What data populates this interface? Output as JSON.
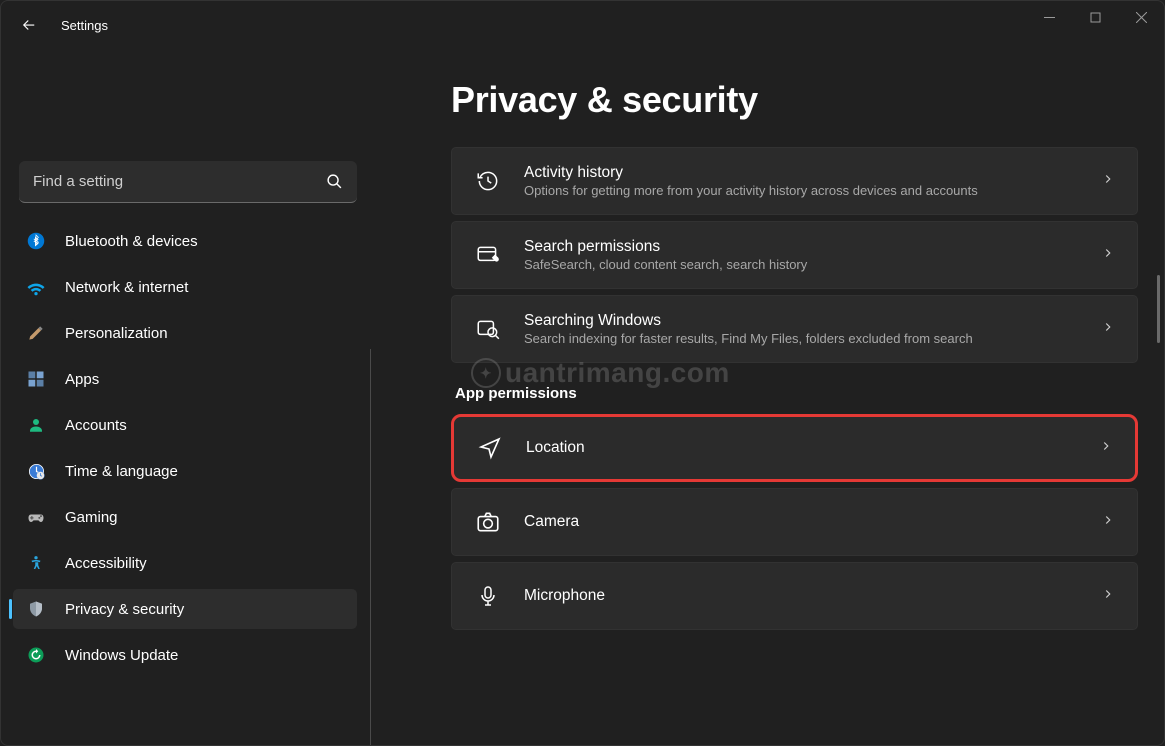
{
  "app": {
    "title": "Settings"
  },
  "search": {
    "placeholder": "Find a setting"
  },
  "sidebar": {
    "items": [
      {
        "label": "Bluetooth & devices"
      },
      {
        "label": "Network & internet"
      },
      {
        "label": "Personalization"
      },
      {
        "label": "Apps"
      },
      {
        "label": "Accounts"
      },
      {
        "label": "Time & language"
      },
      {
        "label": "Gaming"
      },
      {
        "label": "Accessibility"
      },
      {
        "label": "Privacy & security"
      },
      {
        "label": "Windows Update"
      }
    ]
  },
  "main": {
    "title": "Privacy & security",
    "cards_top": [
      {
        "title": "Activity history",
        "sub": "Options for getting more from your activity history across devices and accounts"
      },
      {
        "title": "Search permissions",
        "sub": "SafeSearch, cloud content search, search history"
      },
      {
        "title": "Searching Windows",
        "sub": "Search indexing for faster results, Find My Files, folders excluded from search"
      }
    ],
    "section_label": "App permissions",
    "cards_perm": [
      {
        "title": "Location"
      },
      {
        "title": "Camera"
      },
      {
        "title": "Microphone"
      }
    ]
  },
  "watermark": "uantrimang.com"
}
